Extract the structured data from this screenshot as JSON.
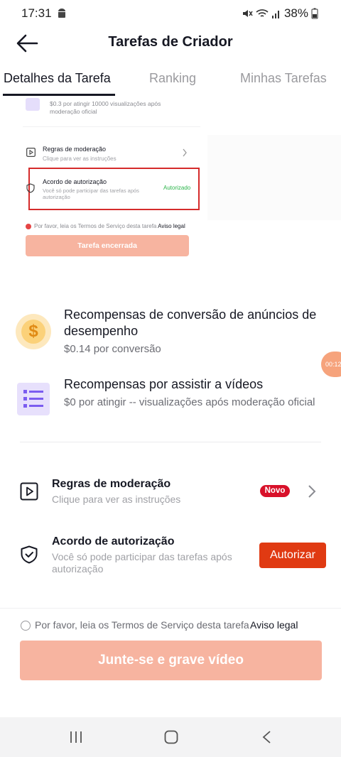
{
  "status_bar": {
    "time": "17:31",
    "battery": "38%"
  },
  "header": {
    "title": "Tarefas de Criador"
  },
  "tabs": [
    {
      "label": "Detalhes da Tarefa",
      "active": true
    },
    {
      "label": "Ranking",
      "active": false
    },
    {
      "label": "Minhas Tarefas",
      "active": false
    }
  ],
  "preview": {
    "reward_line": "$0.3 por atingir 10000 visualizações após moderação oficial",
    "rules_title": "Regras de moderação",
    "rules_sub": "Clique para ver as instruções",
    "auth_title": "Acordo de autorização",
    "auth_sub": "Você só pode participar das tarefas após autorização",
    "auth_status": "Autorizado",
    "terms_text": "Por favor, leia os Termos de Serviço desta tarefa",
    "terms_link": "Aviso legal",
    "button": "Tarefa encerrada"
  },
  "rewards": [
    {
      "title": "Recompensas de conversão de anúncios de desempenho",
      "subtitle": "$0.14 por conversão",
      "icon": "dollar-coin-icon",
      "symbol": "$"
    },
    {
      "title": "Recompensas por assistir a vídeos",
      "subtitle": "$0 por atingir -- visualizações após moderação oficial",
      "icon": "list-icon"
    }
  ],
  "floating_timer": "00:12",
  "rules": {
    "title": "Regras de moderação",
    "subtitle": "Clique para ver as instruções",
    "badge": "Novo"
  },
  "authorization": {
    "title": "Acordo de autorização",
    "subtitle": "Você só pode participar das tarefas após autorização",
    "button": "Autorizar"
  },
  "footer": {
    "terms_text": "Por favor, leia os Termos de Serviço desta tarefa",
    "terms_link": "Aviso legal",
    "join_button": "Junte-se e grave vídeo"
  },
  "colors": {
    "accent": "#e03a12",
    "disabled_button": "#f7b4a0",
    "badge": "#d8112a",
    "success": "#2bb44a"
  }
}
